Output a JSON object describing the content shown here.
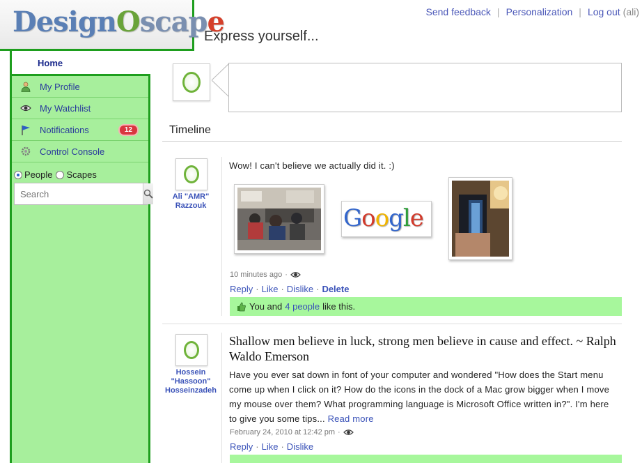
{
  "logo": {
    "text": "DesignOscape"
  },
  "toplinks": {
    "feedback": "Send feedback",
    "personalization": "Personalization",
    "logout": "Log out",
    "user": "(ali)"
  },
  "header": {
    "express": "Express yourself..."
  },
  "sidebar": {
    "home": "Home",
    "items": [
      {
        "label": "My Profile",
        "icon": "profile-icon"
      },
      {
        "label": "My Watchlist",
        "icon": "eye-icon"
      },
      {
        "label": "Notifications",
        "icon": "flag-icon",
        "badge": "12"
      },
      {
        "label": "Control Console",
        "icon": "gear-icon"
      }
    ],
    "search_modes": [
      "People",
      "Scapes"
    ],
    "search_mode_selected": "People",
    "search_placeholder": "Search"
  },
  "timeline": {
    "title": "Timeline",
    "posts": [
      {
        "author": [
          "Ali \"AMR\"",
          "Razzouk"
        ],
        "text": "Wow! I can't believe we actually did it. :)",
        "time": "10 minutes ago",
        "actions": [
          "Reply",
          "Like",
          "Dislike",
          "Delete"
        ],
        "likes": {
          "prefix": "You and",
          "link": "4 people",
          "suffix": "like this."
        }
      },
      {
        "author": [
          "Hossein",
          "\"Hassoon\"",
          "Hosseinzadeh"
        ],
        "quote": "Shallow men believe in luck, strong men believe in cause and effect. ~ Ralph Waldo Emerson",
        "text": "Have you ever sat down in font of your computer and wondered \"How does the Start menu come up when I click on it? How do the icons in the dock of a Mac grow bigger when I move my mouse over them? What programming language is Microsoft Office written in?\". I'm here to give you some tips...",
        "readmore": "Read more",
        "time": "February 24, 2010 at 12:42 pm",
        "actions": [
          "Reply",
          "Like",
          "Dislike"
        ]
      }
    ]
  },
  "colors": {
    "sidebar_bg": "#a7ef9c",
    "sidebar_border": "#1e9e1e",
    "link": "#3a52b8",
    "likebar": "#a7f79c",
    "badge": "#d9363f"
  }
}
